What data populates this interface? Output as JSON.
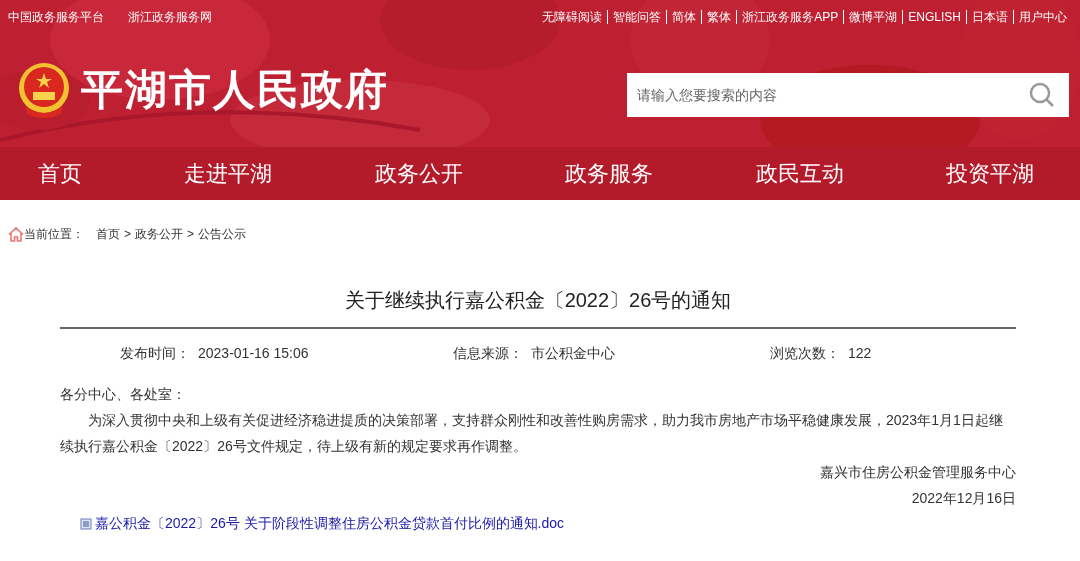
{
  "top_links_left": [
    "中国政务服务平台",
    "浙江政务服务网"
  ],
  "top_links_right": [
    "无障碍阅读",
    "智能问答",
    "简体",
    "繁体",
    "浙江政务服务APP",
    "微博平湖",
    "ENGLISH",
    "日本语",
    "用户中心"
  ],
  "site_title": "平湖市人民政府",
  "search": {
    "placeholder": "请输入您要搜索的内容"
  },
  "nav": [
    "首页",
    "走进平湖",
    "政务公开",
    "政务服务",
    "政民互动",
    "投资平湖"
  ],
  "breadcrumb": {
    "label": "当前位置：",
    "items": [
      "首页",
      "政务公开",
      "公告公示"
    ],
    "separator": ">"
  },
  "article": {
    "title": "关于继续执行嘉公积金〔2022〕26号的通知",
    "meta": [
      {
        "label": "发布时间：",
        "value": "2023-01-16 15:06"
      },
      {
        "label": "信息来源：",
        "value": "市公积金中心"
      },
      {
        "label": "浏览次数：",
        "value": "122"
      }
    ],
    "salutation": "各分中心、各处室：",
    "body": "为深入贯彻中央和上级有关促进经济稳进提质的决策部署，支持群众刚性和改善性购房需求，助力我市房地产市场平稳健康发展，2023年1月1日起继续执行嘉公积金〔2022〕26号文件规定，待上级有新的规定要求再作调整。",
    "signature": "嘉兴市住房公积金管理服务中心",
    "date": "2022年12月16日",
    "attachment": "嘉公积金〔2022〕26号 关于阶段性调整住房公积金贷款首付比例的通知.doc"
  }
}
